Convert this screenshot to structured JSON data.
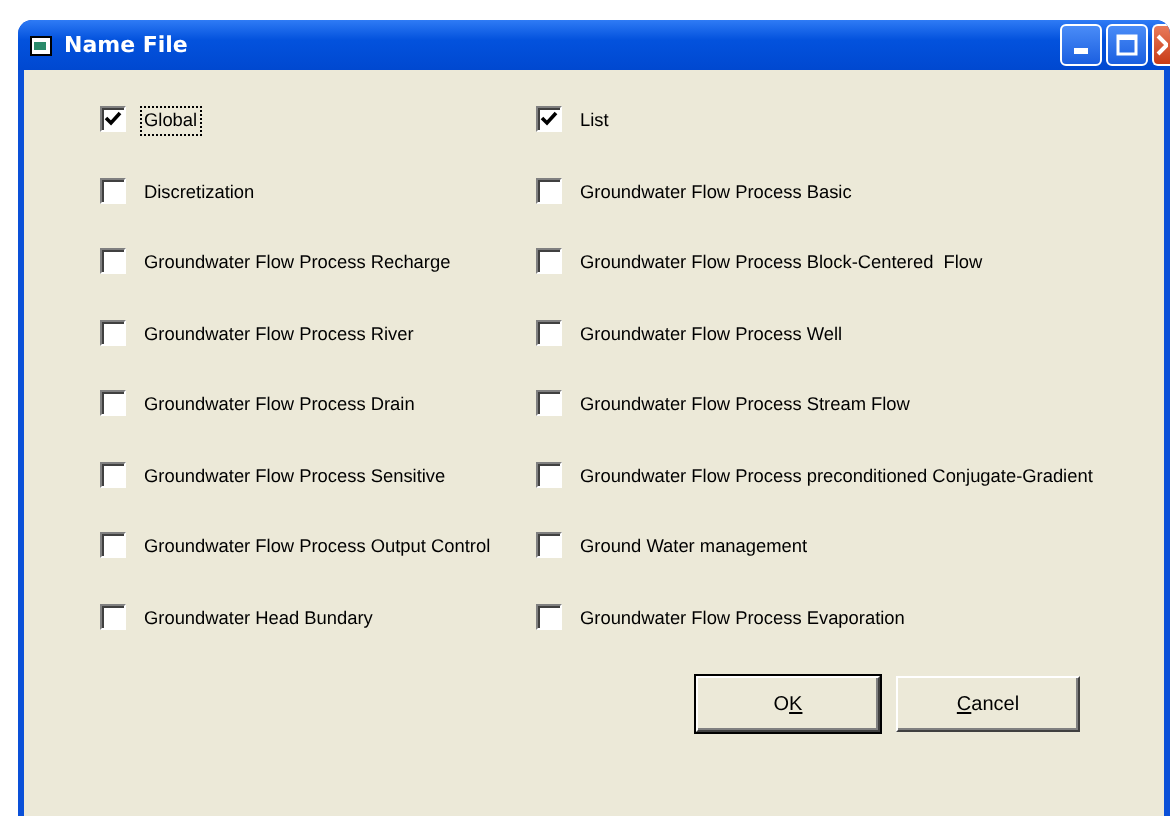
{
  "window": {
    "title": "Name File"
  },
  "columns": [
    [
      {
        "label": "Global",
        "checked": true,
        "focused": true
      },
      {
        "label": "Discretization",
        "checked": false,
        "focused": false
      },
      {
        "label": "Groundwater Flow Process Recharge",
        "checked": false,
        "focused": false
      },
      {
        "label": "Groundwater Flow Process River",
        "checked": false,
        "focused": false
      },
      {
        "label": "Groundwater Flow Process Drain",
        "checked": false,
        "focused": false
      },
      {
        "label": "Groundwater Flow Process Sensitive",
        "checked": false,
        "focused": false
      },
      {
        "label": "Groundwater Flow Process Output Control",
        "checked": false,
        "focused": false
      },
      {
        "label": "Groundwater Head Bundary",
        "checked": false,
        "focused": false
      }
    ],
    [
      {
        "label": "List",
        "checked": true,
        "focused": false
      },
      {
        "label": "Groundwater Flow Process Basic",
        "checked": false,
        "focused": false
      },
      {
        "label": "Groundwater Flow Process Block-Centered  Flow",
        "checked": false,
        "focused": false
      },
      {
        "label": "Groundwater Flow Process Well",
        "checked": false,
        "focused": false
      },
      {
        "label": "Groundwater Flow Process Stream Flow",
        "checked": false,
        "focused": false
      },
      {
        "label": "Groundwater Flow Process preconditioned Conjugate-Gradient",
        "checked": false,
        "focused": false
      },
      {
        "label": "Ground Water management",
        "checked": false,
        "focused": false
      },
      {
        "label": "Groundwater Flow Process Evaporation",
        "checked": false,
        "focused": false
      }
    ]
  ],
  "buttons": [
    {
      "before": "O",
      "mnemonic": "K",
      "default": true
    },
    {
      "mnemonic": "C",
      "after": "ancel",
      "default": false
    }
  ]
}
